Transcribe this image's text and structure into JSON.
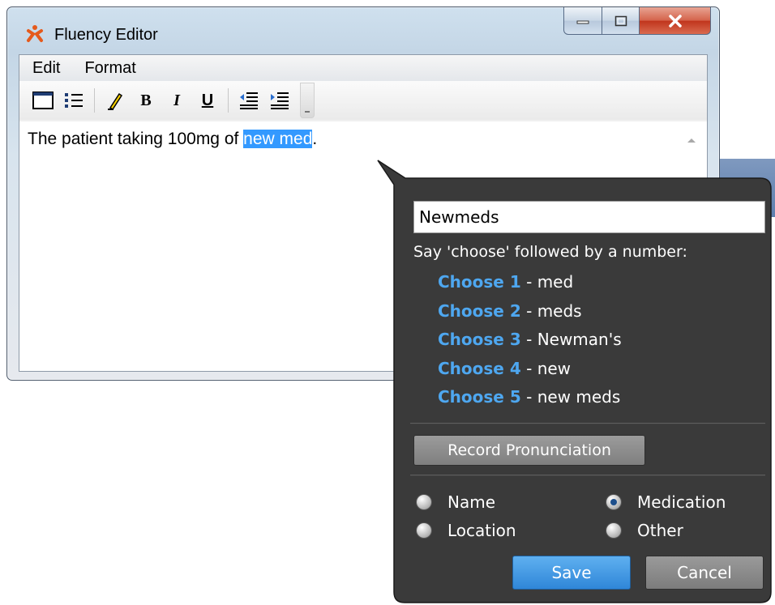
{
  "window": {
    "title": "Fluency Editor",
    "caption": {
      "min_icon": "minimize-icon",
      "max_icon": "maximize-icon",
      "close_icon": "close-icon"
    }
  },
  "menu": {
    "items": [
      "Edit",
      "Format"
    ]
  },
  "toolbar": {
    "buttons": [
      {
        "name": "view-icon"
      },
      {
        "name": "bullet-list-icon"
      },
      {
        "name": "highlighter-icon"
      },
      {
        "name": "bold",
        "label": "B"
      },
      {
        "name": "italic",
        "label": "I"
      },
      {
        "name": "underline",
        "label": "U"
      },
      {
        "name": "decrease-indent-icon"
      },
      {
        "name": "increase-indent-icon"
      }
    ]
  },
  "document": {
    "text_before": "The patient taking 100mg of ",
    "selected_text": "new med",
    "text_after": "."
  },
  "popup": {
    "input_value": "Newmeds",
    "instruction": "Say 'choose' followed by a number:",
    "choices": [
      {
        "command": "Choose 1",
        "word": "med"
      },
      {
        "command": "Choose 2",
        "word": "meds"
      },
      {
        "command": "Choose 3",
        "word": "Newman's"
      },
      {
        "command": "Choose 4",
        "word": "new"
      },
      {
        "command": "Choose 5",
        "word": "new meds"
      }
    ],
    "record_label": "Record Pronunciation",
    "categories": [
      {
        "label": "Name",
        "checked": false
      },
      {
        "label": "Medication",
        "checked": true
      },
      {
        "label": "Location",
        "checked": false
      },
      {
        "label": "Other",
        "checked": false
      }
    ],
    "save_label": "Save",
    "cancel_label": "Cancel"
  },
  "colors": {
    "selection": "#3399ff",
    "popup_bg": "#3b3b3b",
    "choice_command": "#4ea7f0",
    "save_button": "#2f86d8"
  }
}
